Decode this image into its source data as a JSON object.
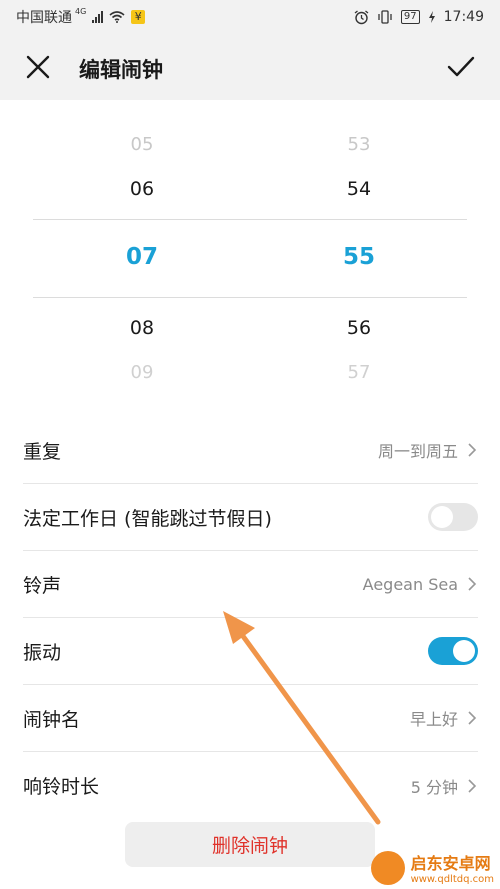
{
  "status_bar": {
    "carrier": "中国联通",
    "network": "4G",
    "pay_badge": "¥",
    "battery": "97",
    "time": "17:49"
  },
  "header": {
    "title": "编辑闹钟",
    "close_icon": "close-icon",
    "confirm_icon": "checkmark-icon"
  },
  "time_picker": {
    "hours": [
      "05",
      "06",
      "07",
      "08",
      "09"
    ],
    "minutes": [
      "53",
      "54",
      "55",
      "56",
      "57"
    ],
    "selected_hour": "07",
    "selected_minute": "55",
    "accent_color": "#1aa1d6"
  },
  "settings": {
    "repeat": {
      "label": "重复",
      "value": "周一到周五"
    },
    "workday": {
      "label": "法定工作日 (智能跳过节假日)",
      "enabled": false
    },
    "ringtone": {
      "label": "铃声",
      "value": "Aegean Sea"
    },
    "vibrate": {
      "label": "振动",
      "enabled": true
    },
    "alarm_name": {
      "label": "闹钟名",
      "value": "早上好"
    },
    "ring_duration": {
      "label": "响铃时长",
      "value": "5 分钟"
    }
  },
  "delete_button": {
    "label": "删除闹钟",
    "color": "#e0322a"
  },
  "watermark": {
    "name": "启东安卓网",
    "url": "www.qdltdq.com"
  }
}
